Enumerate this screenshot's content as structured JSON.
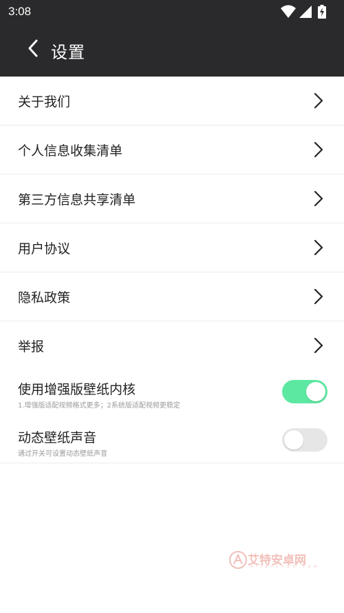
{
  "status_bar": {
    "time": "3:08",
    "icons": [
      "wifi-icon",
      "cellular-signal-icon",
      "battery-charging-icon"
    ]
  },
  "header": {
    "title": "设置",
    "back_icon": "chevron-left-icon"
  },
  "menu": {
    "items": [
      {
        "label": "关于我们"
      },
      {
        "label": "个人信息收集清单"
      },
      {
        "label": "第三方信息共享清单"
      },
      {
        "label": "用户协议"
      },
      {
        "label": "隐私政策"
      },
      {
        "label": "举报"
      }
    ]
  },
  "toggles": [
    {
      "title": "使用增强版壁纸内核",
      "subtitle": "1.增强版适配视频格式更多；2系统版适配视频更稳定",
      "on": true
    },
    {
      "title": "动态壁纸声音",
      "subtitle": "通过开关可设置动态壁纸声音",
      "on": false
    }
  ],
  "watermark": {
    "text": "艾特安卓网",
    "subtext": "aitanzhuo.com"
  },
  "colors": {
    "bar_background": "#2a2a2c",
    "toggle_on": "#5de8a2",
    "toggle_off": "#e6e6e6",
    "divider": "#ececec",
    "watermark": "#d94b3a"
  }
}
